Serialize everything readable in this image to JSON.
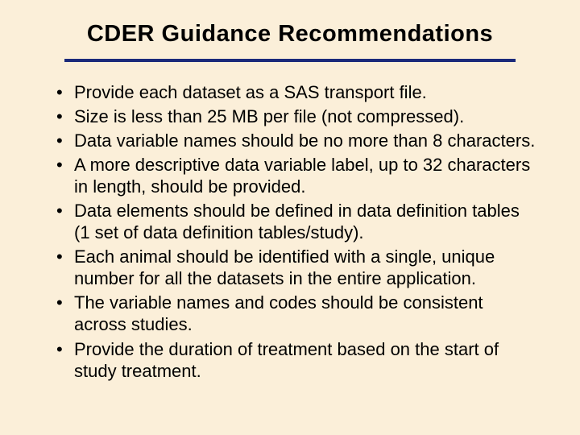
{
  "title": "CDER Guidance Recommendations",
  "bullets": [
    "Provide each dataset as a SAS transport file.",
    "Size is less than 25 MB per file (not compressed).",
    "Data variable names should be no more than 8 characters.",
    "A more descriptive data variable label, up to 32 characters in length, should be provided.",
    "Data elements should be defined in data definition tables (1 set of data definition tables/study).",
    "Each animal should be identified with a single, unique number for all the datasets in the entire application.",
    "The variable names and codes should be consistent across studies.",
    " Provide the duration of treatment based on the start of study treatment."
  ]
}
